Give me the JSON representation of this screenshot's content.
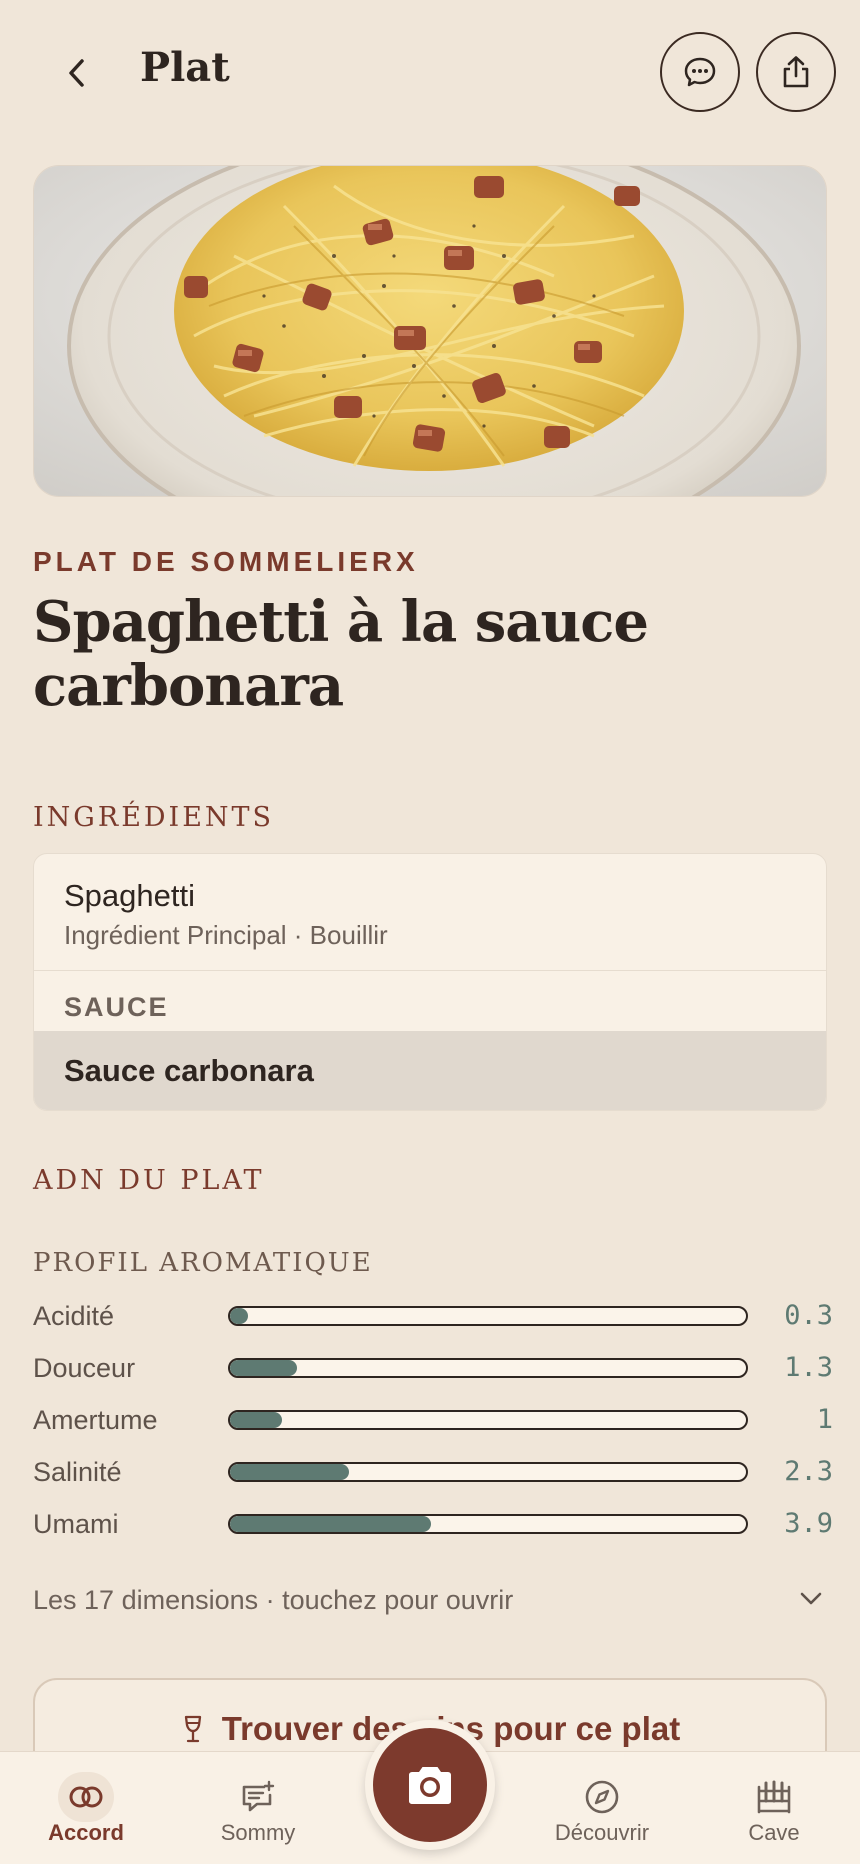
{
  "header": {
    "title": "Plat"
  },
  "dish": {
    "eyebrow": "PLAT DE SOMMELIERX",
    "title": "Spaghetti à la sauce carbonara"
  },
  "ingredients": {
    "section_label": "INGRÉDIENTS",
    "main": {
      "name": "Spaghetti",
      "meta": "Ingrédient Principal · Bouillir"
    },
    "sauce_header": "SAUCE",
    "sauce": {
      "name": "Sauce carbonara"
    }
  },
  "adn": {
    "section_label": "ADN DU PLAT",
    "profile_label": "PROFIL AROMATIQUE",
    "scale_max": 10,
    "bars": [
      {
        "label": "Acidité",
        "value": 0.3,
        "display": "0.3"
      },
      {
        "label": "Douceur",
        "value": 1.3,
        "display": "1.3"
      },
      {
        "label": "Amertume",
        "value": 1,
        "display": "1"
      },
      {
        "label": "Salinité",
        "value": 2.3,
        "display": "2.3"
      },
      {
        "label": "Umami",
        "value": 3.9,
        "display": "3.9"
      }
    ],
    "dimensions_text": "Les 17 dimensions · touchez pour ouvrir"
  },
  "cta": {
    "label": "Trouver des vins pour ce plat"
  },
  "tabbar": {
    "tabs": [
      {
        "label": "Accord",
        "icon": "rings-icon",
        "active": true
      },
      {
        "label": "Sommy",
        "icon": "chat-sparkle-icon",
        "active": false
      },
      {
        "label": "Découvrir",
        "icon": "compass-icon",
        "active": false
      },
      {
        "label": "Cave",
        "icon": "wine-rack-icon",
        "active": false
      }
    ]
  },
  "colors": {
    "background": "#f0e6d9",
    "accent": "#7a3a2c",
    "bar_fill": "#5e7a72",
    "card": "#f9f1e6"
  }
}
